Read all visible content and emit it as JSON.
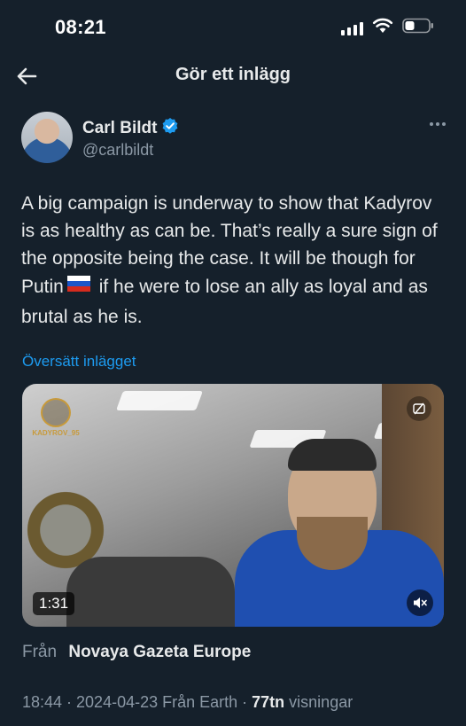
{
  "status_bar": {
    "time": "08:21",
    "icons": [
      "signal-icon",
      "wifi-icon",
      "battery-icon"
    ]
  },
  "header": {
    "title": "Gör ett inlägg",
    "back_icon": "arrow-left-icon"
  },
  "author": {
    "name": "Carl Bildt",
    "handle": "@carlbildt",
    "verified": true,
    "verified_color": "#1d9bf0"
  },
  "tweet": {
    "text_before_flag": "A big campaign is underway to show that Kadyrov is as healthy as can be. That’s really a sure sign of the opposite being the case. It will be though for Putin",
    "flag": "russia-flag-icon",
    "text_after_flag": " if he were to lose an ally as loyal and as brutal as he is.",
    "translate_label": "Översätt inlägget"
  },
  "media": {
    "watermark": "KADYROV_95",
    "duration": "1:31",
    "mute_icon": "volume-mute-icon"
  },
  "source": {
    "label": "Från",
    "name": "Novaya Gazeta Europe"
  },
  "meta": {
    "time_date": "18:44 · 2024-04-23 Från Earth · ",
    "views_count": "77tn",
    "views_label": " visningar"
  },
  "colors": {
    "background": "#15202b",
    "accent": "#1d9bf0",
    "secondary_text": "#8b98a5"
  }
}
